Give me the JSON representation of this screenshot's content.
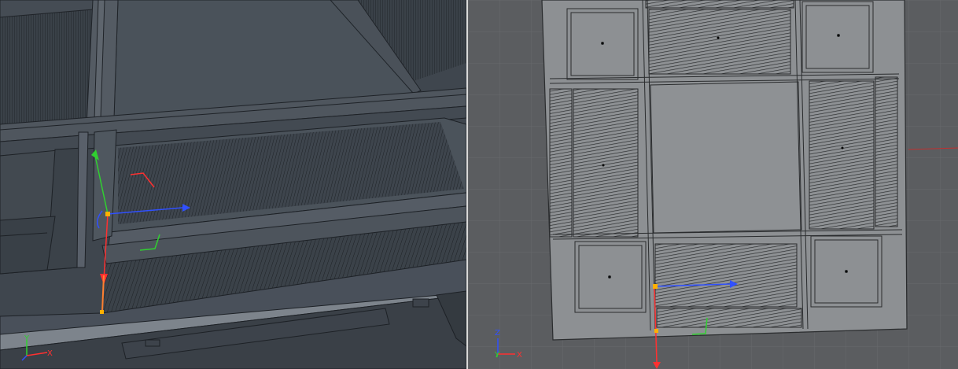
{
  "viewports": [
    {
      "id": "perspective",
      "axis_labels": [
        "Y",
        "X"
      ]
    },
    {
      "id": "top",
      "axis_labels": [
        "Z",
        "Y",
        "X"
      ]
    }
  ],
  "colors": {
    "axis_x": "#ff3030",
    "axis_y": "#30d030",
    "axis_z": "#3050ff",
    "handle": "#ffb000"
  }
}
